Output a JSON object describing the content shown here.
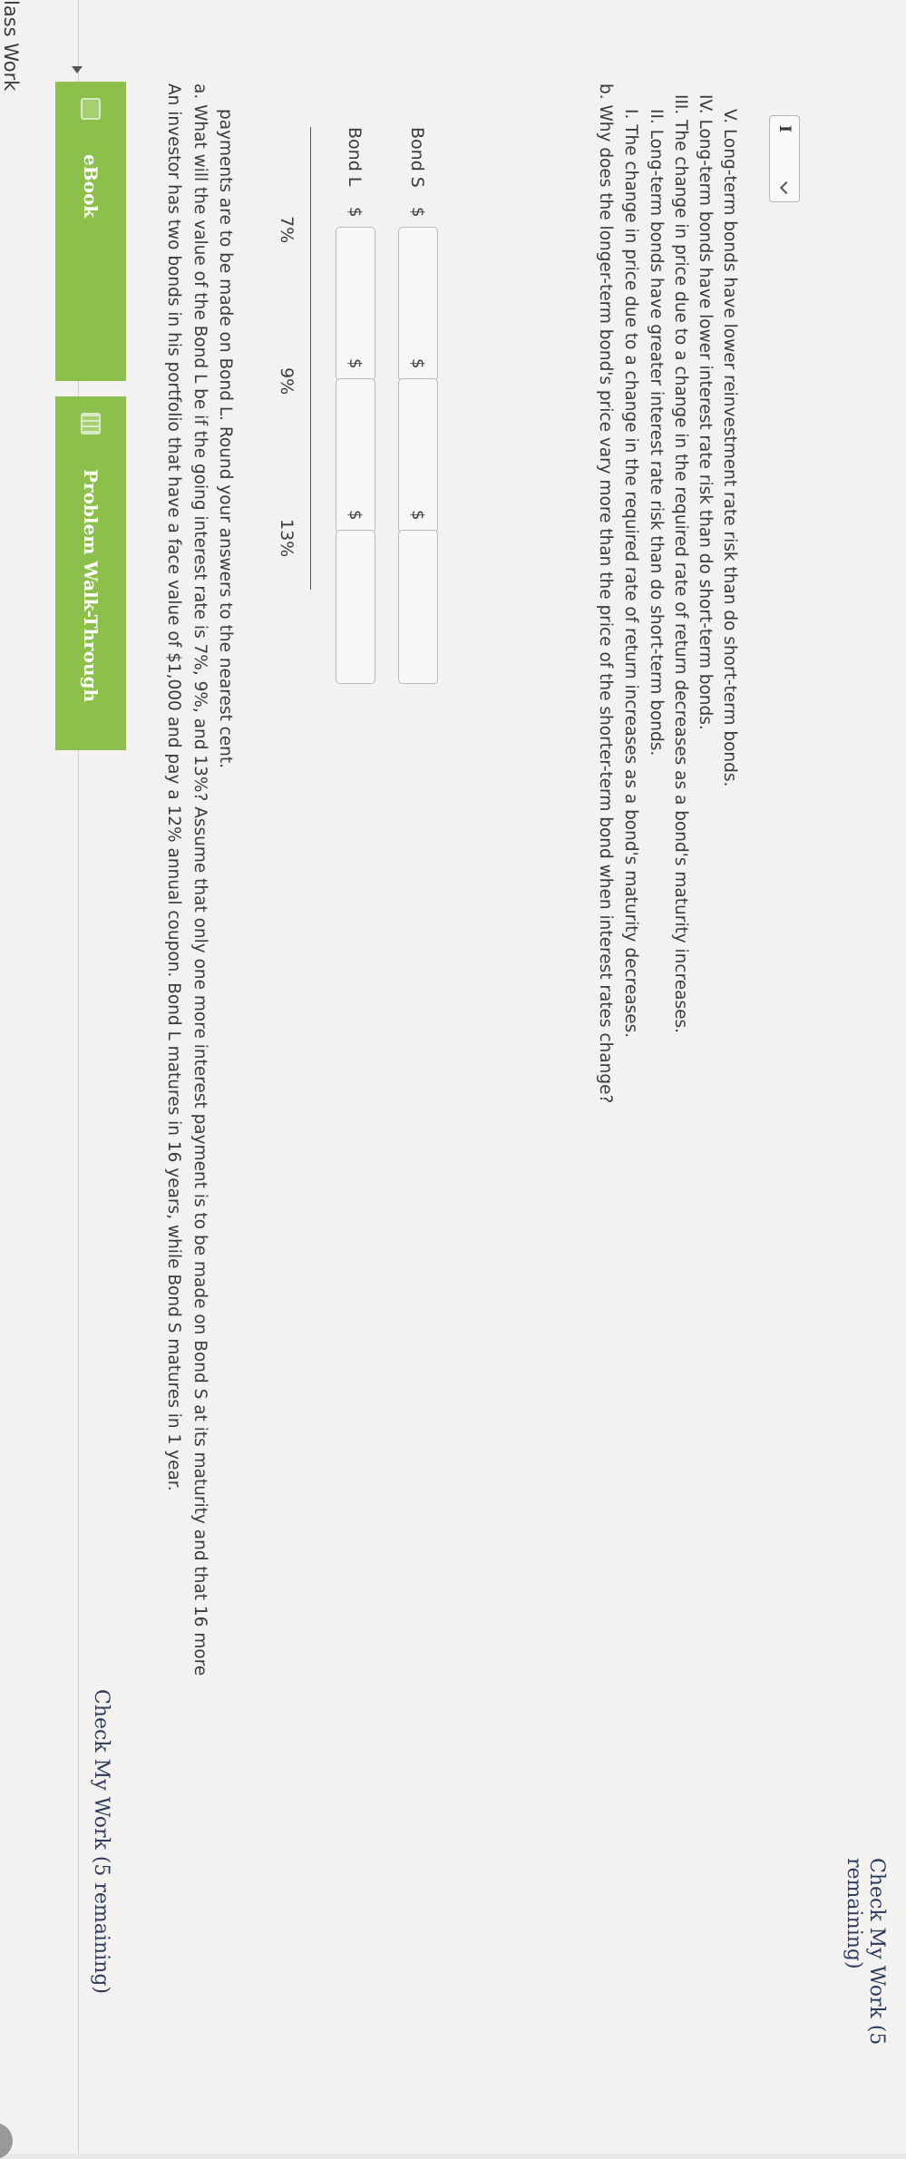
{
  "header": {
    "title": "lass Work"
  },
  "check_work_label": "Check My Work (5 remaining)",
  "tabs": [
    {
      "label": "eBook",
      "icon": "ebook-icon"
    },
    {
      "label": "Problem Walk-Through",
      "icon": "video-icon"
    }
  ],
  "problem": {
    "intro": "An investor has two bonds in his portfolio that have a face value of $1,000 and pay a 12% annual coupon. Bond L matures in 16 years, while Bond S matures in 1 year.",
    "part_a_line1": "a. What will the value of the Bond L be if the going interest rate is 7%, 9%, and 13%? Assume that only one more interest payment is to be made on Bond S at its maturity and that 16 more",
    "part_a_line2": "payments are to be made on Bond L. Round your answers to the nearest cent."
  },
  "table": {
    "columns": [
      "7%",
      "9%",
      "13%"
    ],
    "rows": [
      {
        "label": "Bond L",
        "currency": "$"
      },
      {
        "label": "Bond S",
        "currency": "$"
      }
    ]
  },
  "part_b": {
    "question": "b. Why does the longer-term bond's price vary more than the price of the shorter-term bond when interest rates change?",
    "options": [
      "I. The change in price due to a change in the required rate of return increases as a bond's maturity decreases.",
      "II. Long-term bonds have greater interest rate risk than do short-term bonds.",
      "III. The change in price due to a change in the required rate of return decreases as a bond's maturity increases.",
      "IV. Long-term bonds have lower interest rate risk than do short-term bonds.",
      "V. Long-term bonds have lower reinvestment rate risk than do short-term bonds."
    ],
    "selected": "I"
  }
}
